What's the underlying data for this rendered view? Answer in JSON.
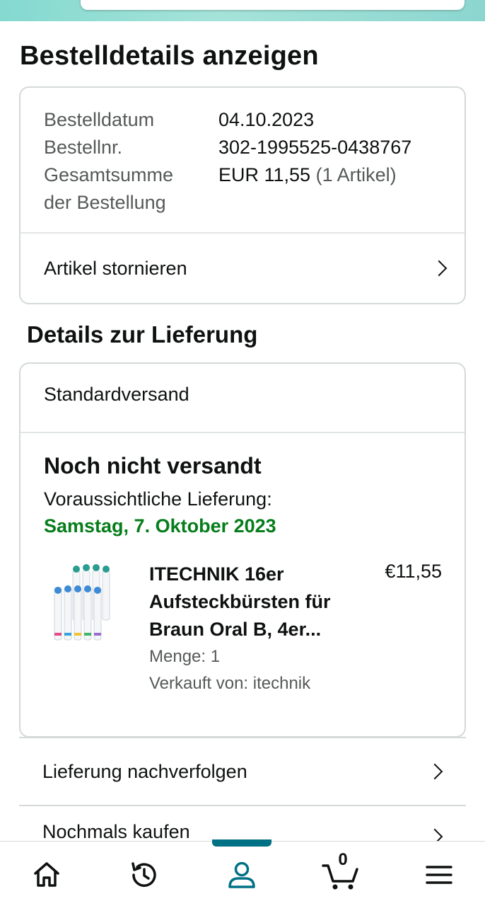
{
  "page": {
    "title": "Bestelldetails anzeigen"
  },
  "order": {
    "date_label": "Bestelldatum",
    "date_value": "04.10.2023",
    "number_label": "Bestellnr.",
    "number_value": "302-1995525-0438767",
    "total_label_line1": "Gesamtsumme",
    "total_label_line2": "der Bestellung",
    "total_value": "EUR 11,55",
    "total_items": "(1 Artikel)",
    "cancel_label": "Artikel stornieren"
  },
  "delivery": {
    "section_title": "Details zur Lieferung",
    "shipping_method": "Standardversand",
    "status": "Noch nicht versandt",
    "expected_label": "Voraussichtliche Lieferung:",
    "expected_date": "Samstag, 7. Oktober 2023",
    "product": {
      "title_line1": "ITECHNIK 16er",
      "title_line2": "Aufsteckbürsten für",
      "title_line3": "Braun Oral B, 4er...",
      "price": "€11,55",
      "quantity": "Menge: 1",
      "seller": "Verkauft von: itechnik",
      "image_icon": "toothbrush-heads-product-image"
    }
  },
  "actions": {
    "track": "Lieferung nachverfolgen",
    "buy_again": "Nochmals kaufen"
  },
  "nav": {
    "items": [
      {
        "name": "home",
        "icon": "home-icon"
      },
      {
        "name": "history",
        "icon": "history-icon"
      },
      {
        "name": "account",
        "icon": "account-icon",
        "active": true
      },
      {
        "name": "cart",
        "icon": "cart-icon",
        "count": "0"
      },
      {
        "name": "menu",
        "icon": "menu-icon"
      }
    ]
  },
  "colors": {
    "accent": "#007185",
    "delivery_green": "#067d1b",
    "border": "#d5d9d9"
  }
}
